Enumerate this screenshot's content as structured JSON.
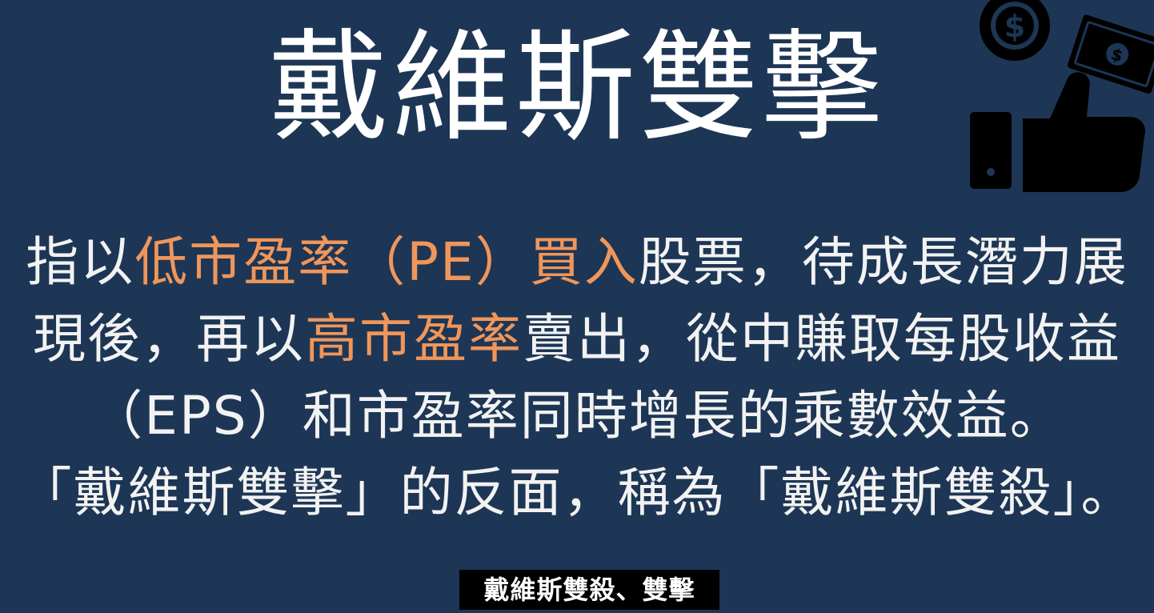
{
  "title": "戴維斯雙擊",
  "body": {
    "line1": {
      "a": "指以",
      "b": "低市盈率（PE）買入",
      "c": "股票，待成長潛力展"
    },
    "line2": {
      "a": "現後，再以",
      "b": "高市盈率",
      "c": "賣出，從中賺取每股收益"
    },
    "line3": "（EPS）和市盈率同時增長的乘數效益。",
    "line4": "「戴維斯雙擊」的反面，稱為「戴維斯雙殺」。"
  },
  "subtitle": "戴維斯雙殺、雙擊",
  "icon": "money-thumbs-up-icon",
  "colors": {
    "background": "#1d3655",
    "highlight": "#f0965a",
    "text": "#f2f2f2"
  }
}
